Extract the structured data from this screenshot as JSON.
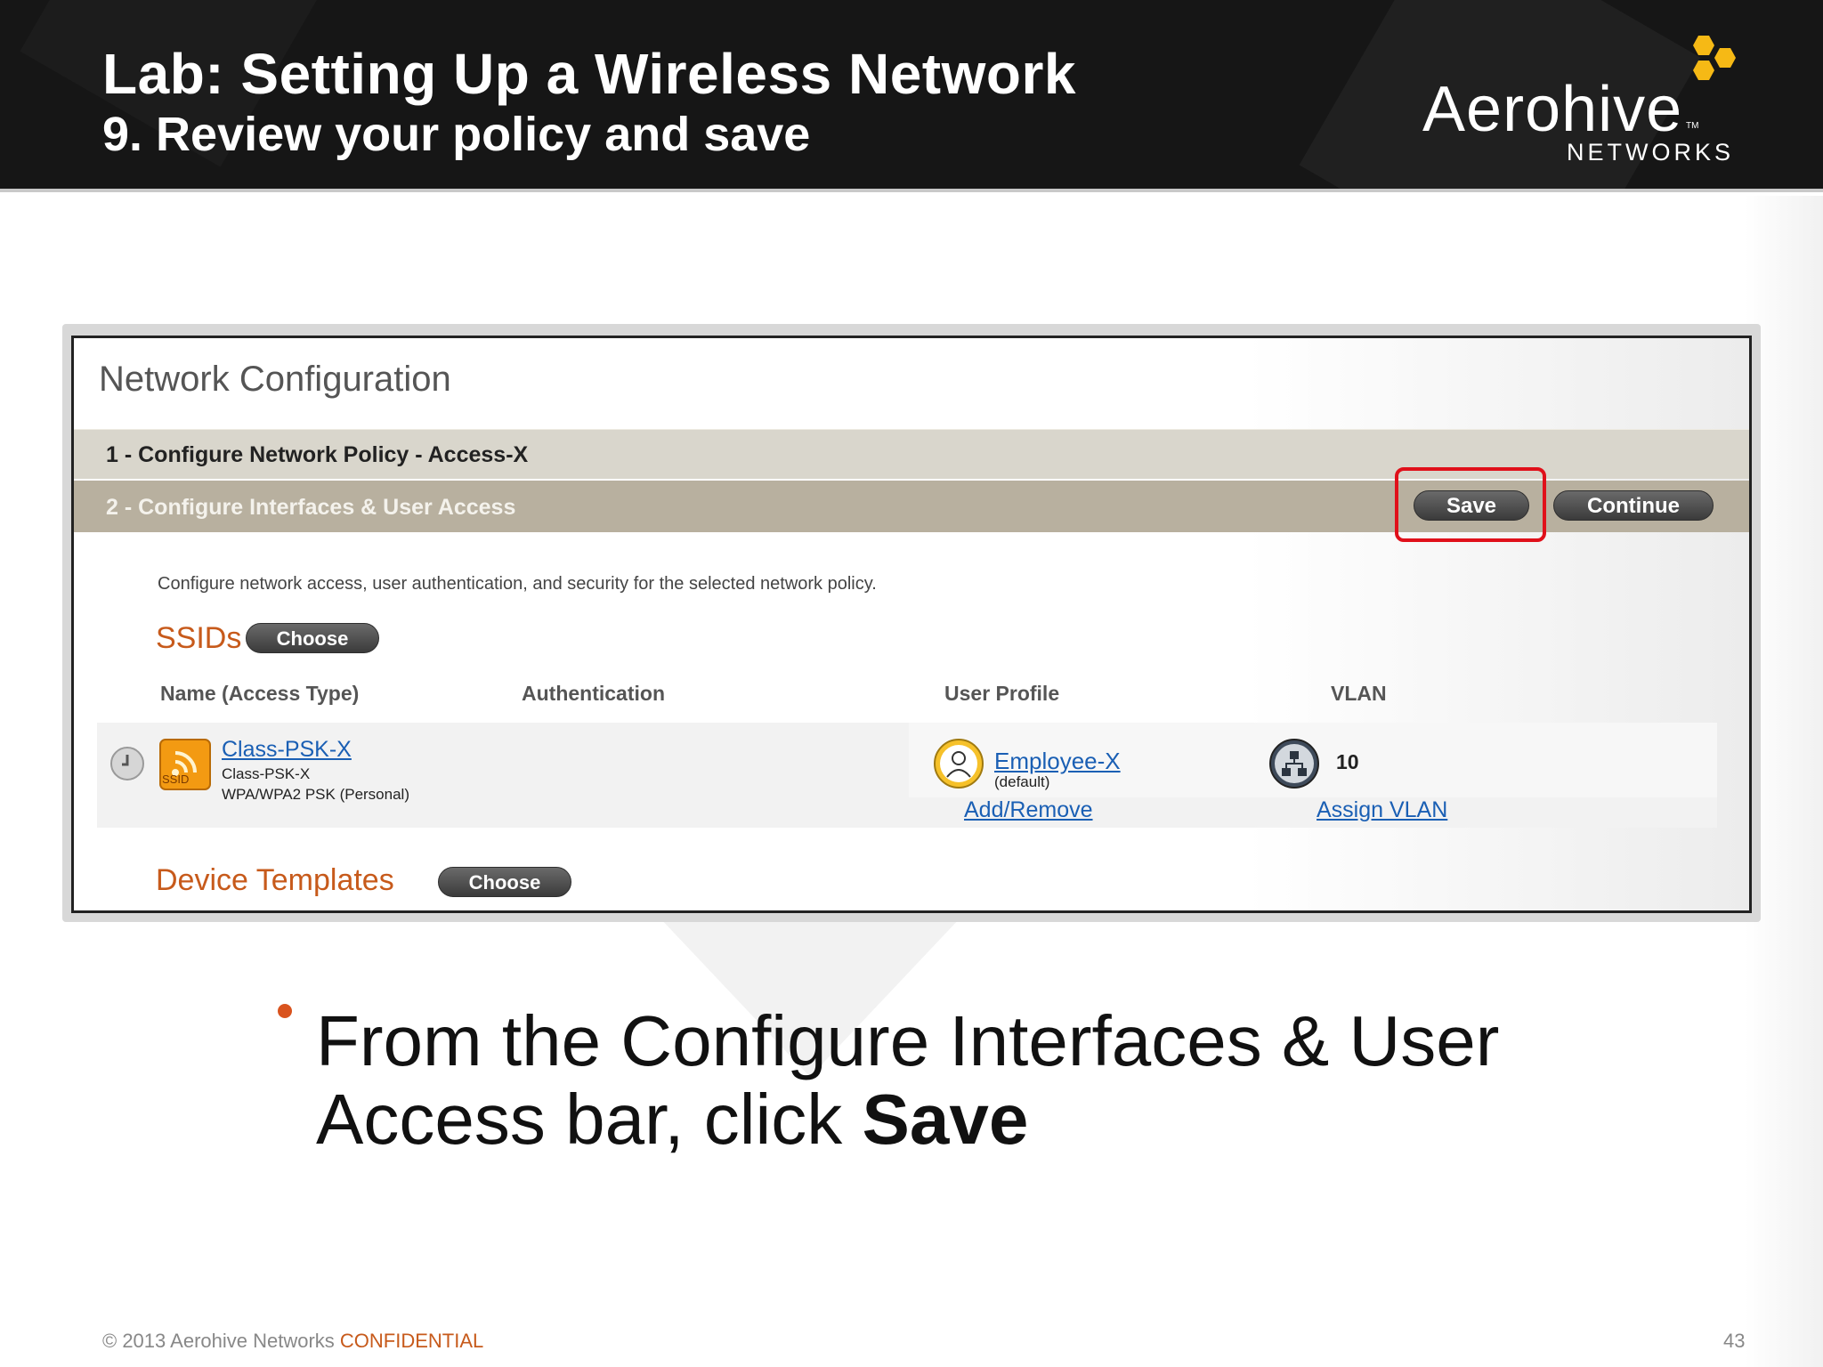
{
  "slide": {
    "title": "Lab: Setting Up a Wireless Network",
    "subtitle": "9. Review your policy and save",
    "logo": {
      "word": "Aerohive",
      "tm": "TM",
      "sub": "NETWORKS"
    },
    "accent_color": "#d9531e",
    "logo_hex_color": "#f6b915"
  },
  "panel": {
    "title": "Network Configuration",
    "step1": "1 - Configure Network Policy - Access-X",
    "step2": "2 - Configure Interfaces & User Access",
    "save_label": "Save",
    "continue_label": "Continue",
    "description": "Configure network access, user authentication, and security for the selected network policy.",
    "ssids": {
      "heading": "SSIDs",
      "choose_label": "Choose"
    },
    "columns": [
      "Name (Access Type)",
      "Authentication",
      "User Profile",
      "VLAN"
    ],
    "row": {
      "ssid_badge": "SSID",
      "ssid_link": "Class-PSK-X",
      "ssid_name": "Class-PSK-X",
      "ssid_security": "WPA/WPA2 PSK (Personal)",
      "profile_link": "Employee-X",
      "profile_note": "(default)",
      "add_remove": "Add/Remove",
      "vlan_value": "10",
      "assign_vlan": "Assign VLAN"
    },
    "device_templates": {
      "heading": "Device Templates",
      "choose_label": "Choose"
    }
  },
  "bullet": {
    "text_before": "From the Configure Interfaces & User Access bar, click ",
    "text_bold": "Save"
  },
  "footer": {
    "copyright": "© 2013 Aerohive Networks",
    "confidential": "CONFIDENTIAL",
    "page_number": "43"
  }
}
